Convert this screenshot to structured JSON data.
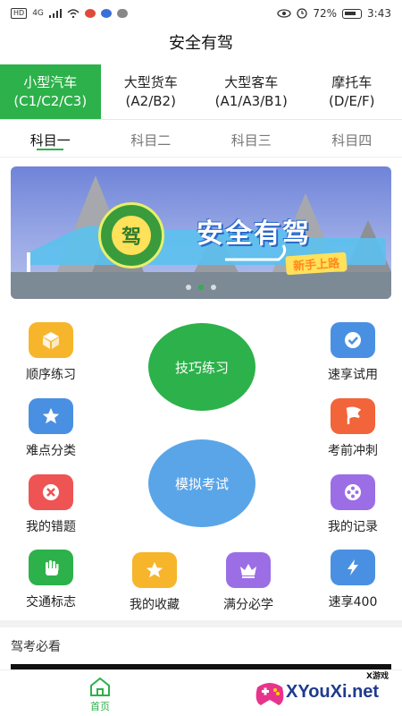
{
  "status_bar": {
    "hd": "HD",
    "network": "4G",
    "battery": "72%",
    "time": "3:43"
  },
  "app": {
    "title": "安全有驾"
  },
  "vehicle_tabs": [
    {
      "name": "小型汽车",
      "code": "(C1/C2/C3)",
      "active": true
    },
    {
      "name": "大型货车",
      "code": "(A2/B2)",
      "active": false
    },
    {
      "name": "大型客车",
      "code": "(A1/A3/B1)",
      "active": false
    },
    {
      "name": "摩托车",
      "code": "(D/E/F)",
      "active": false
    }
  ],
  "subject_tabs": [
    {
      "label": "科目一",
      "active": true
    },
    {
      "label": "科目二",
      "active": false
    },
    {
      "label": "科目三",
      "active": false
    },
    {
      "label": "科目四",
      "active": false
    }
  ],
  "banner": {
    "title": "安全有驾",
    "subtitle": "新手上路",
    "badge_char": "驾",
    "slide_count": 3,
    "active_slide": 1
  },
  "grid": {
    "sequential": {
      "label": "顺序练习",
      "icon": "cube-icon",
      "color": "#f7b52c"
    },
    "speed_trial": {
      "label": "速享试用",
      "icon": "check-icon",
      "color": "#4a90e2"
    },
    "difficulty": {
      "label": "难点分类",
      "icon": "star-icon",
      "color": "#4a90e2"
    },
    "sprint": {
      "label": "考前冲刺",
      "icon": "flag-icon",
      "color": "#f2643a"
    },
    "mistakes": {
      "label": "我的错题",
      "icon": "x-icon",
      "color": "#ee5454"
    },
    "records": {
      "label": "我的记录",
      "icon": "film-reel-icon",
      "color": "#9b6ee6"
    },
    "traffic_signs": {
      "label": "交通标志",
      "icon": "hand-icon",
      "color": "#2db14a"
    },
    "favorites": {
      "label": "我的收藏",
      "icon": "star-icon",
      "color": "#f7b52c"
    },
    "must_learn": {
      "label": "满分必学",
      "icon": "crown-icon",
      "color": "#9b6ee6"
    },
    "speed_400": {
      "label": "速享400",
      "icon": "lightning-icon",
      "color": "#4a90e2"
    }
  },
  "big_buttons": {
    "skill": {
      "label": "技巧练习",
      "color": "#2db14a"
    },
    "mock": {
      "label": "模拟考试",
      "color": "#5aa5e8"
    }
  },
  "section": {
    "title": "驾考必看"
  },
  "bottom_nav": {
    "home": "首页"
  },
  "watermark": {
    "text": "XYouXi.net",
    "small": "X游戏"
  }
}
